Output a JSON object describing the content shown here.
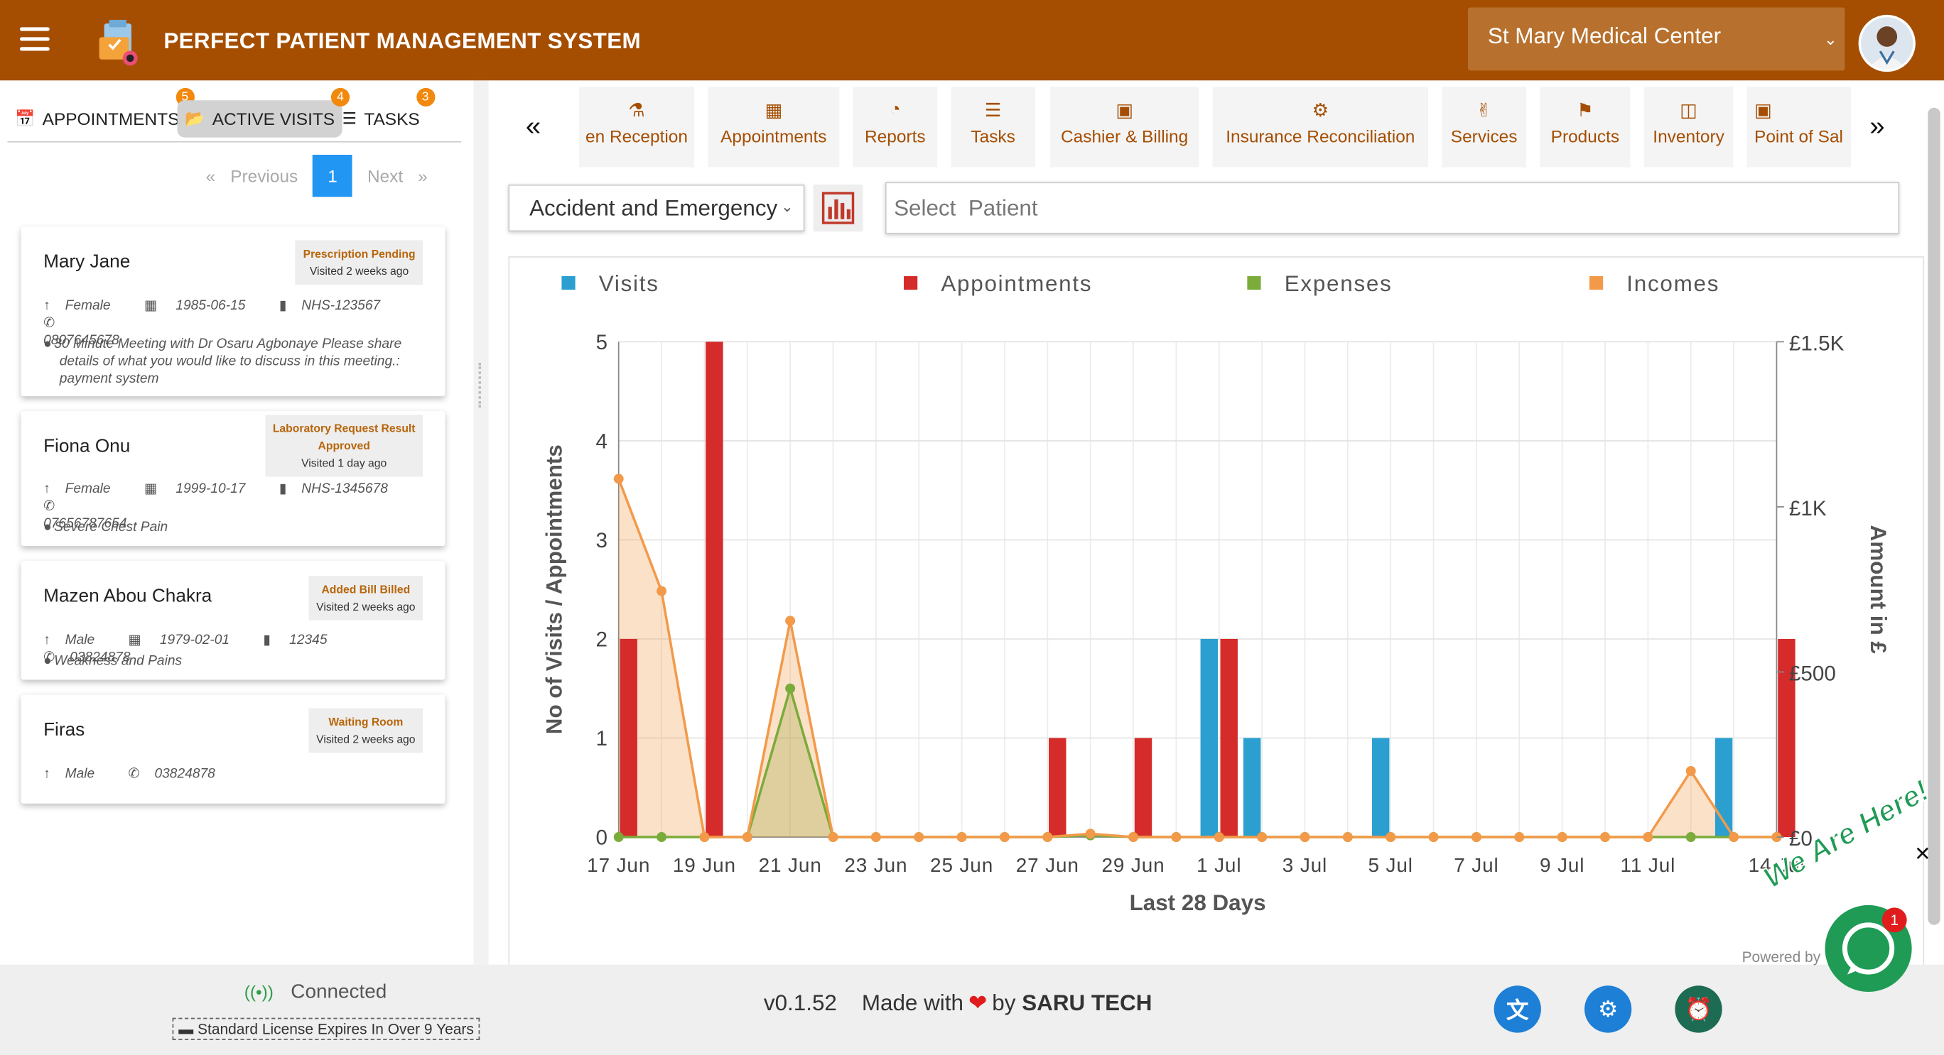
{
  "header": {
    "title": "PERFECT PATIENT MANAGEMENT SYSTEM",
    "facility": "St Mary Medical Center"
  },
  "left_tabs": [
    {
      "label": "APPOINTMENTS",
      "badge": "5",
      "icon": "calendar-check-icon"
    },
    {
      "label": "ACTIVE VISITS",
      "badge": "4",
      "icon": "folder-open-icon"
    },
    {
      "label": "TASKS",
      "badge": "3",
      "icon": "tasks-list-icon"
    }
  ],
  "pagination": {
    "previous": "Previous",
    "current": "1",
    "next": "Next"
  },
  "visits": [
    {
      "name": "Mary Jane",
      "status": "Prescription Pending",
      "status2": "",
      "visited": "Visited 2 weeks ago",
      "gender": "Female",
      "dob": "1985-06-15",
      "nhs": "NHS-123567",
      "phone": "0807645678",
      "note": "30 Minute Meeting with Dr Osaru Agbonaye Please share details of what you would like to discuss in this meeting.: payment system"
    },
    {
      "name": "Fiona Onu",
      "status": "Laboratory Request Result",
      "status2": "Approved",
      "visited": "Visited 1 day ago",
      "gender": "Female",
      "dob": "1999-10-17",
      "nhs": "NHS-1345678",
      "phone": "07656787654",
      "note": "Severe Chest Pain"
    },
    {
      "name": "Mazen Abou Chakra",
      "status": "Added Bill Billed",
      "status2": "",
      "visited": "Visited 2 weeks ago",
      "gender": "Male",
      "dob": "1979-02-01",
      "nhs": "12345",
      "phone": "03824878",
      "note": "Weakness and Pains"
    },
    {
      "name": "Firas",
      "status": "Waiting Room",
      "status2": "",
      "visited": "Visited 2 weeks ago",
      "gender": "Male",
      "dob": "",
      "nhs": "",
      "phone": "03824878",
      "note": ""
    }
  ],
  "modules": [
    {
      "label": "en Reception",
      "icon": "flask-icon"
    },
    {
      "label": "Appointments",
      "icon": "calendar-icon"
    },
    {
      "label": "Reports",
      "icon": "pie-chart-icon"
    },
    {
      "label": "Tasks",
      "icon": "tasks-list-icon"
    },
    {
      "label": "Cashier & Billing",
      "icon": "cash-register-icon"
    },
    {
      "label": "Insurance Reconciliation",
      "icon": "money-refresh-icon"
    },
    {
      "label": "Services",
      "icon": "hand-holding-icon"
    },
    {
      "label": "Products",
      "icon": "tag-icon"
    },
    {
      "label": "Inventory",
      "icon": "box-archive-icon"
    },
    {
      "label": "Point of Sal",
      "icon": "cash-register-icon"
    }
  ],
  "filters": {
    "department": "Accident and Emergency",
    "patient_placeholder": "Select  Patient"
  },
  "chart_data": {
    "type": "bar",
    "xlabel": "Last 28 Days",
    "ylabel": "No of Visits / Appointments",
    "y2label": "Amount in £",
    "ylim": [
      0,
      5
    ],
    "y2lim": [
      0,
      1500
    ],
    "yticks": [
      "0",
      "1",
      "2",
      "3",
      "4",
      "5"
    ],
    "y2ticks": [
      "£0",
      "£500",
      "£1K",
      "£1.5K"
    ],
    "xticks": [
      "17 Jun",
      "19 Jun",
      "21 Jun",
      "23 Jun",
      "25 Jun",
      "27 Jun",
      "29 Jun",
      "1 Jul",
      "3 Jul",
      "5 Jul",
      "7 Jul",
      "9 Jul",
      "11 Jul",
      "14 Jul"
    ],
    "categories": [
      "17 Jun",
      "18 Jun",
      "19 Jun",
      "20 Jun",
      "21 Jun",
      "22 Jun",
      "23 Jun",
      "24 Jun",
      "25 Jun",
      "26 Jun",
      "27 Jun",
      "28 Jun",
      "29 Jun",
      "30 Jun",
      "1 Jul",
      "2 Jul",
      "3 Jul",
      "4 Jul",
      "5 Jul",
      "6 Jul",
      "7 Jul",
      "8 Jul",
      "9 Jul",
      "10 Jul",
      "11 Jul",
      "12 Jul",
      "13 Jul",
      "14 Jul"
    ],
    "legend_position": "top",
    "grid": true,
    "series": [
      {
        "name": "Visits",
        "type": "bar",
        "axis": "left",
        "color": "#2a9fd0",
        "values": [
          0,
          0,
          0,
          0,
          0,
          0,
          0,
          0,
          0,
          0,
          0,
          0,
          0,
          0,
          2,
          1,
          0,
          0,
          1,
          0,
          0,
          0,
          0,
          0,
          0,
          0,
          1,
          0
        ]
      },
      {
        "name": "Appointments",
        "type": "bar",
        "axis": "left",
        "color": "#d52b2b",
        "values": [
          2,
          0,
          5,
          0,
          0,
          0,
          0,
          0,
          0,
          0,
          1,
          0,
          1,
          0,
          2,
          0,
          0,
          0,
          0,
          0,
          0,
          0,
          0,
          0,
          0,
          0,
          0,
          2
        ]
      },
      {
        "name": "Expenses",
        "type": "area",
        "axis": "right",
        "color": "#7bab3a",
        "values": [
          0,
          0,
          0,
          0,
          450,
          0,
          0,
          0,
          0,
          0,
          0,
          5,
          0,
          0,
          0,
          0,
          0,
          0,
          0,
          0,
          0,
          0,
          0,
          0,
          0,
          0,
          0,
          0
        ]
      },
      {
        "name": "Incomes",
        "type": "area",
        "axis": "right",
        "color": "#f29a4a",
        "values": [
          1085,
          745,
          0,
          0,
          655,
          0,
          0,
          0,
          0,
          0,
          0,
          10,
          0,
          0,
          0,
          0,
          0,
          0,
          0,
          0,
          0,
          0,
          0,
          0,
          0,
          200,
          0,
          0
        ]
      }
    ]
  },
  "footer": {
    "connection": "Connected",
    "license": "Standard License Expires In Over 9 Years",
    "version": "v0.1.52",
    "made_with": "Made with",
    "by": "by",
    "company": "SARU TECH"
  },
  "chat": {
    "label": "We Are Here!",
    "badge": "1",
    "powered": "Powered by"
  },
  "colors": {
    "brand": "#a54e02",
    "accent": "#2196f3",
    "badge": "#f2880c"
  }
}
